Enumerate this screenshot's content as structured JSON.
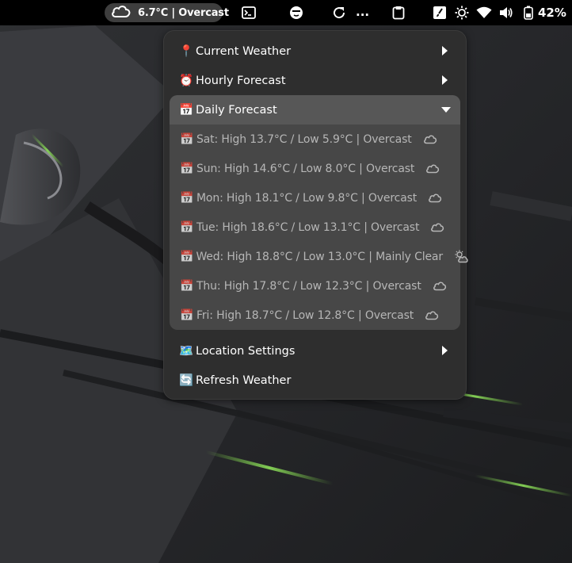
{
  "topbar": {
    "weather_label": "6.7°C | Overcast",
    "weather_icon": "cloud-icon",
    "ellipsis": "...",
    "battery_percent": "42%",
    "icons": [
      "terminal-icon",
      "face-icon",
      "refresh-icon",
      "clipboard-icon",
      "brush-icon",
      "brightness-icon",
      "wifi-icon",
      "volume-icon",
      "battery-icon"
    ]
  },
  "menu": {
    "current_weather": {
      "emoji": "📍",
      "label": "Current Weather"
    },
    "hourly_forecast": {
      "emoji": "⏰",
      "label": "Hourly Forecast"
    },
    "daily_forecast": {
      "emoji": "📅",
      "label": "Daily Forecast",
      "expanded": true,
      "days": [
        {
          "label": "Sat: High 13.7°C / Low 5.9°C | Overcast",
          "icon": "cloud-icon"
        },
        {
          "label": "Sun: High 14.6°C / Low 8.0°C | Overcast",
          "icon": "cloud-icon"
        },
        {
          "label": "Mon: High 18.1°C / Low 9.8°C | Overcast",
          "icon": "cloud-icon"
        },
        {
          "label": "Tue: High 18.6°C / Low 13.1°C | Overcast",
          "icon": "cloud-icon"
        },
        {
          "label": "Wed: High 18.8°C / Low 13.0°C | Mainly Clear",
          "icon": "sun-cloud-icon"
        },
        {
          "label": "Thu: High 17.8°C / Low 12.3°C | Overcast",
          "icon": "cloud-icon"
        },
        {
          "label": "Fri: High 18.7°C / Low 12.8°C | Overcast",
          "icon": "cloud-icon"
        }
      ]
    },
    "location_settings": {
      "emoji": "🗺️",
      "label": "Location Settings"
    },
    "refresh_weather": {
      "emoji": "🔄",
      "label": "Refresh Weather"
    }
  },
  "colors": {
    "topbar": "#000000",
    "menu_bg": "#2e2e2e",
    "submenu_bg": "#474747",
    "submenu_header": "#575757",
    "wallpaper_accent": "#7fd34a"
  }
}
